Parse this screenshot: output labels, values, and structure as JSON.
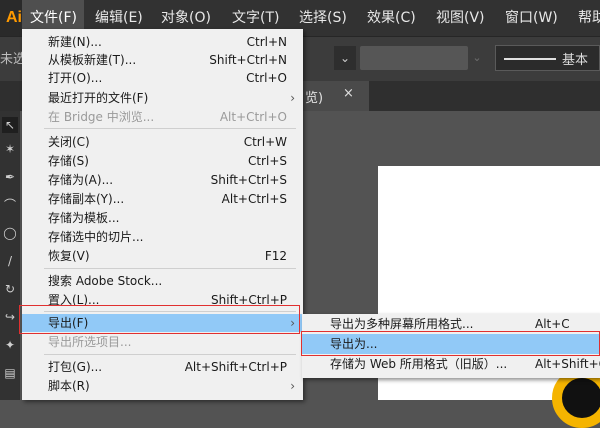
{
  "menubar": {
    "logo": "Ai",
    "items": [
      "文件(F)",
      "编辑(E)",
      "对象(O)",
      "文字(T)",
      "选择(S)",
      "效果(C)",
      "视图(V)",
      "窗口(W)",
      "帮助"
    ]
  },
  "controlbar": {
    "left_text": "未选",
    "stroke_label": "基本"
  },
  "tab": {
    "title": "览)",
    "close": "×"
  },
  "file_menu": {
    "items": [
      {
        "label": "新建(N)...",
        "shortcut": "Ctrl+N"
      },
      {
        "label": "从模板新建(T)...",
        "shortcut": "Shift+Ctrl+N"
      },
      {
        "label": "打开(O)...",
        "shortcut": "Ctrl+O"
      },
      {
        "label": "最近打开的文件(F)",
        "shortcut": ""
      },
      {
        "label": "在 Bridge 中浏览...",
        "shortcut": "Alt+Ctrl+O"
      },
      {
        "label": "关闭(C)",
        "shortcut": "Ctrl+W"
      },
      {
        "label": "存储(S)",
        "shortcut": "Ctrl+S"
      },
      {
        "label": "存储为(A)...",
        "shortcut": "Shift+Ctrl+S"
      },
      {
        "label": "存储副本(Y)...",
        "shortcut": "Alt+Ctrl+S"
      },
      {
        "label": "存储为模板...",
        "shortcut": ""
      },
      {
        "label": "存储选中的切片...",
        "shortcut": ""
      },
      {
        "label": "恢复(V)",
        "shortcut": "F12"
      },
      {
        "label": "搜索 Adobe Stock...",
        "shortcut": ""
      },
      {
        "label": "置入(L)...",
        "shortcut": "Shift+Ctrl+P"
      },
      {
        "label": "导出(F)",
        "shortcut": ""
      },
      {
        "label": "导出所选项目...",
        "shortcut": ""
      },
      {
        "label": "打包(G)...",
        "shortcut": "Alt+Shift+Ctrl+P"
      },
      {
        "label": "脚本(R)",
        "shortcut": ""
      }
    ]
  },
  "export_submenu": {
    "items": [
      {
        "label": "导出为多种屏幕所用格式...",
        "shortcut": "Alt+C"
      },
      {
        "label": "导出为...",
        "shortcut": ""
      },
      {
        "label": "存储为 Web 所用格式（旧版）...",
        "shortcut": "Alt+Shift+C"
      }
    ]
  }
}
